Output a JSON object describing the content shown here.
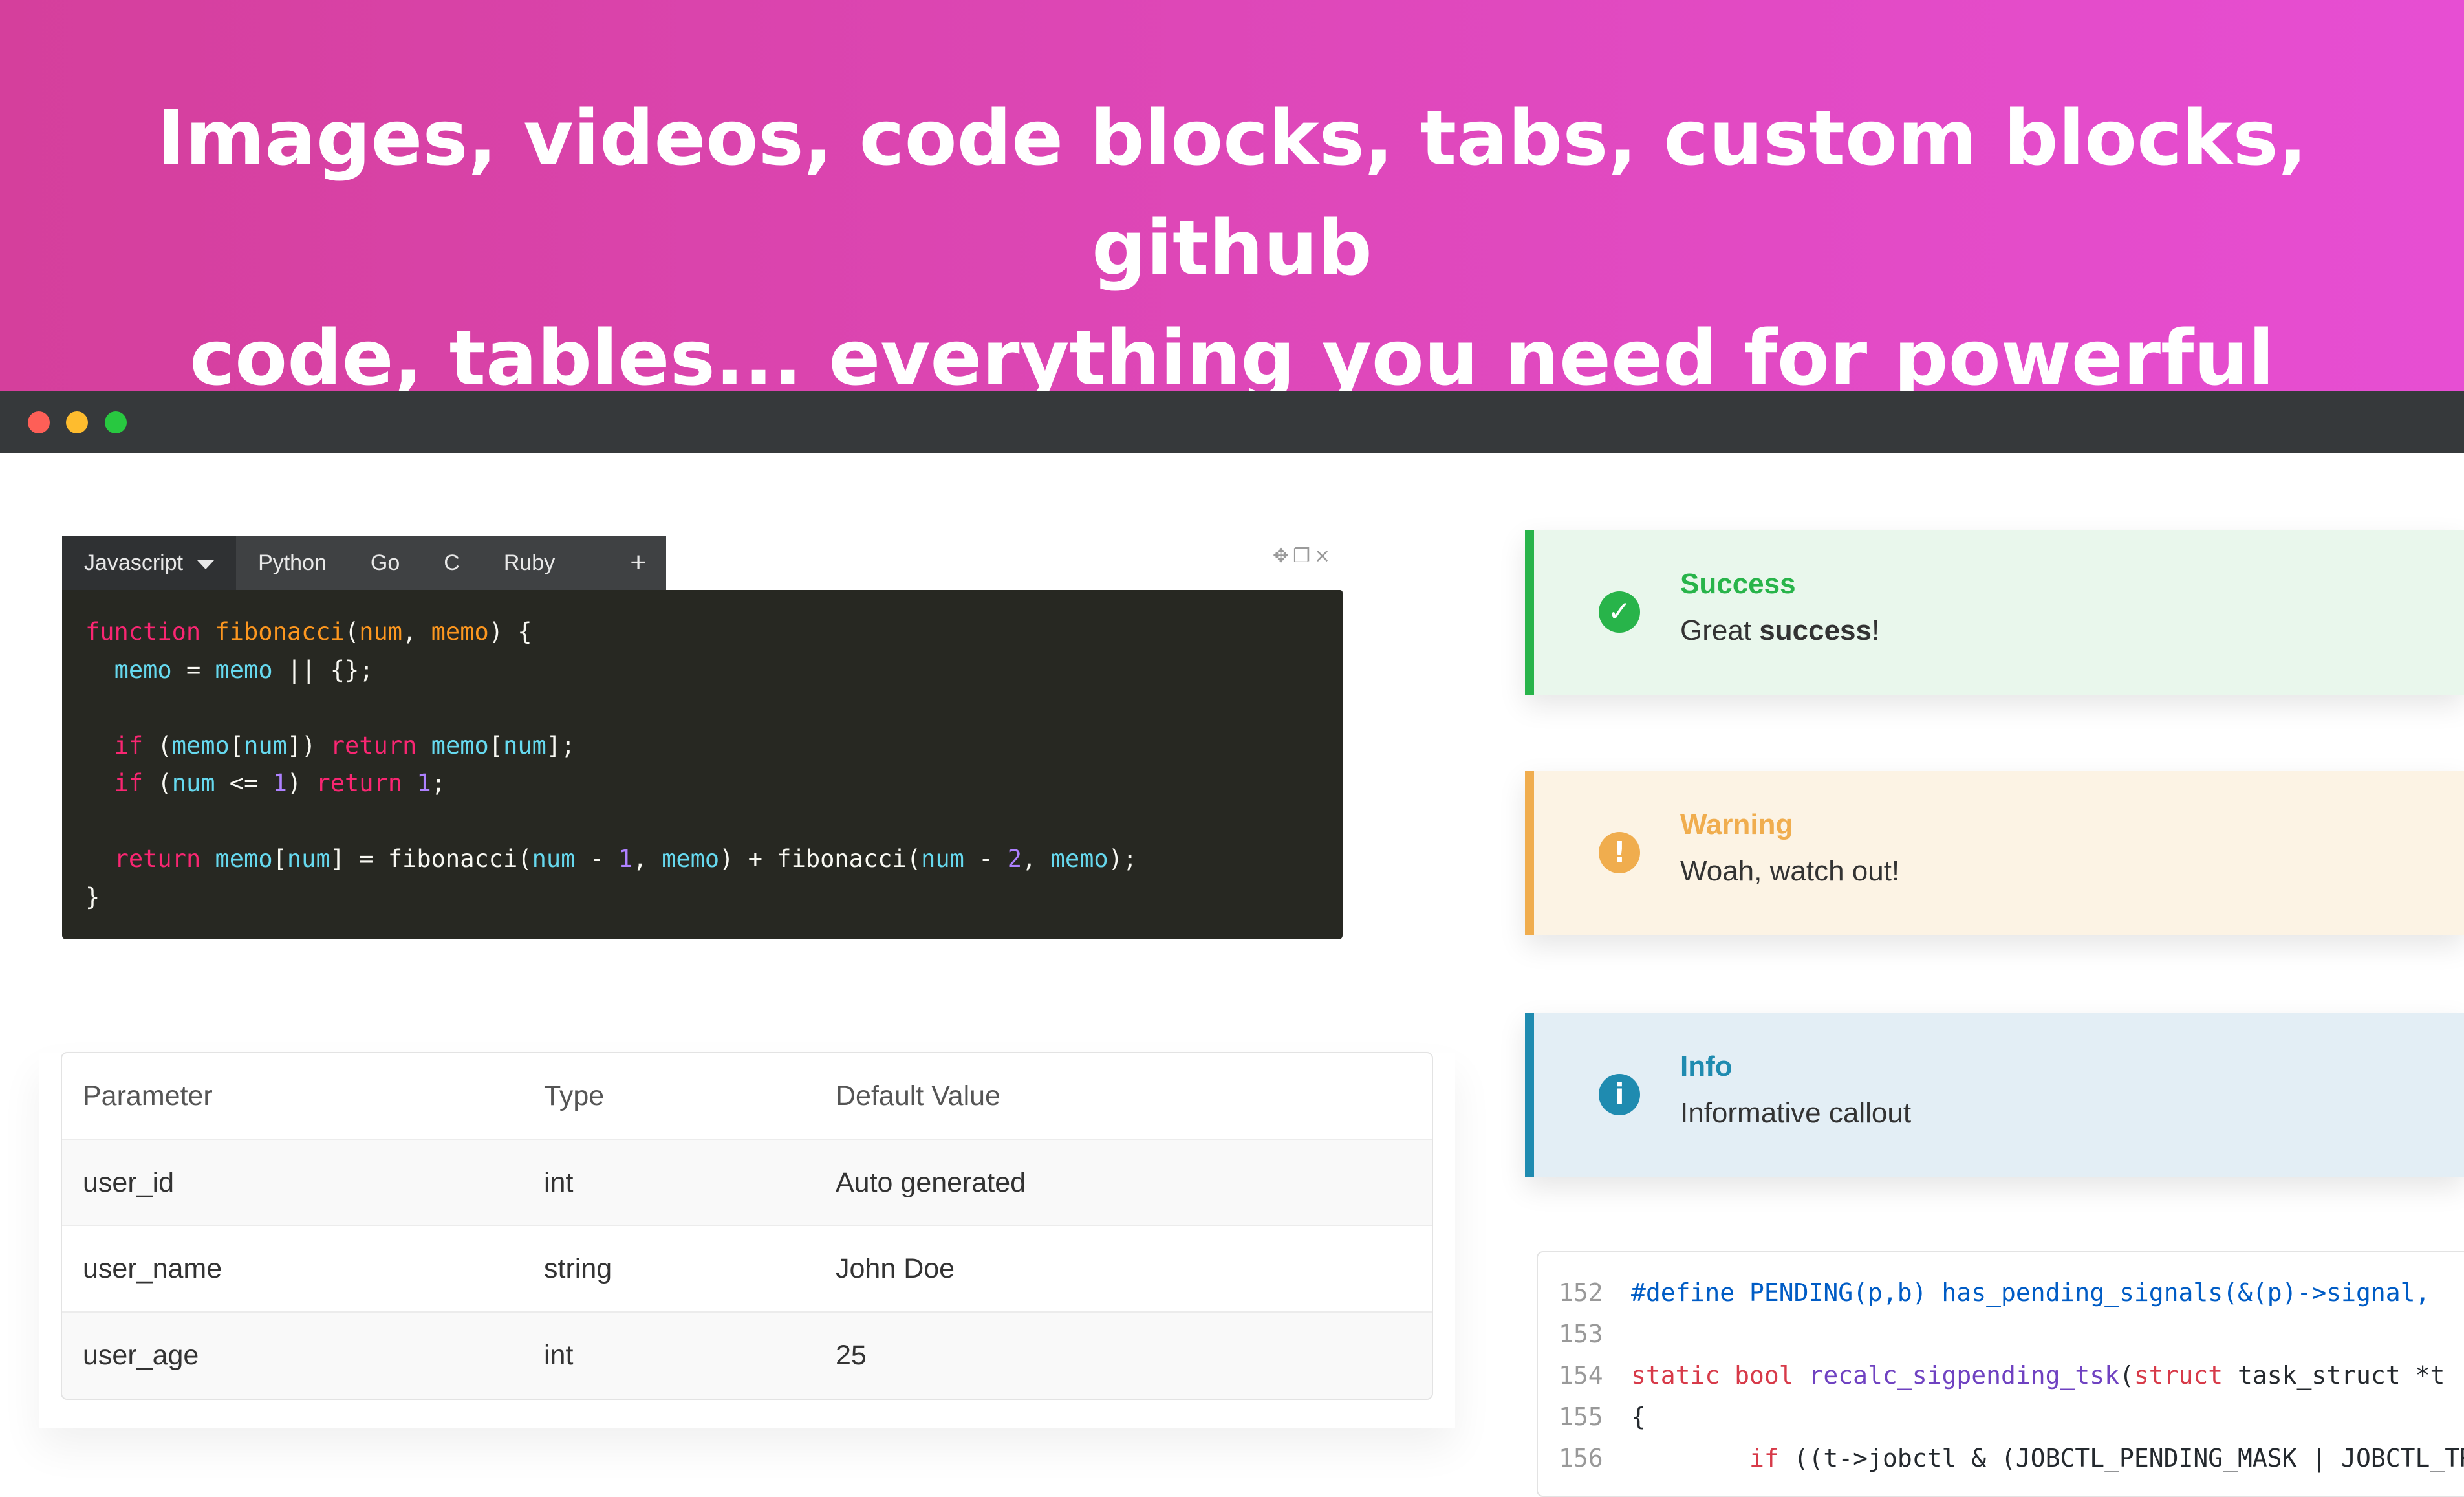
{
  "hero": {
    "line1": "Images, videos, code blocks, tabs, custom blocks, github",
    "line2": "code, tables... everything you need for powerful docs"
  },
  "window": {
    "buttons": [
      "close",
      "minimize",
      "maximize"
    ]
  },
  "code_tabs": {
    "tabs": [
      "Javascript",
      "Python",
      "Go",
      "C",
      "Ruby"
    ],
    "active_tab": "Javascript",
    "add_label": "+",
    "toolbar_icons": [
      "move-icon",
      "copy-icon",
      "close-icon"
    ],
    "toolbar_glyphs": [
      "✥",
      "❐",
      "×"
    ]
  },
  "code": {
    "lines": [
      [
        [
          "kw",
          "function "
        ],
        [
          "fn",
          "fibonacci"
        ],
        [
          "op",
          "("
        ],
        [
          "pa",
          "num"
        ],
        [
          "op",
          ", "
        ],
        [
          "pa",
          "memo"
        ],
        [
          "op",
          ") {"
        ]
      ],
      [
        [
          "op",
          "  "
        ],
        [
          "va",
          "memo"
        ],
        [
          "op",
          " = "
        ],
        [
          "va",
          "memo"
        ],
        [
          "op",
          " || {};"
        ]
      ],
      [],
      [
        [
          "op",
          "  "
        ],
        [
          "kw",
          "if"
        ],
        [
          "op",
          " ("
        ],
        [
          "va",
          "memo"
        ],
        [
          "op",
          "["
        ],
        [
          "va",
          "num"
        ],
        [
          "op",
          "]) "
        ],
        [
          "kw",
          "return"
        ],
        [
          "op",
          " "
        ],
        [
          "va",
          "memo"
        ],
        [
          "op",
          "["
        ],
        [
          "va",
          "num"
        ],
        [
          "op",
          "];"
        ]
      ],
      [
        [
          "op",
          "  "
        ],
        [
          "kw",
          "if"
        ],
        [
          "op",
          " ("
        ],
        [
          "va",
          "num"
        ],
        [
          "op",
          " <= "
        ],
        [
          "nu",
          "1"
        ],
        [
          "op",
          ") "
        ],
        [
          "kw",
          "return"
        ],
        [
          "op",
          " "
        ],
        [
          "nu",
          "1"
        ],
        [
          "op",
          ";"
        ]
      ],
      [],
      [
        [
          "op",
          "  "
        ],
        [
          "kw",
          "return"
        ],
        [
          "op",
          " "
        ],
        [
          "va",
          "memo"
        ],
        [
          "op",
          "["
        ],
        [
          "va",
          "num"
        ],
        [
          "op",
          "] = fibonacci("
        ],
        [
          "va",
          "num"
        ],
        [
          "op",
          " - "
        ],
        [
          "nu",
          "1"
        ],
        [
          "op",
          ", "
        ],
        [
          "va",
          "memo"
        ],
        [
          "op",
          ") + fibonacci("
        ],
        [
          "va",
          "num"
        ],
        [
          "op",
          " - "
        ],
        [
          "nu",
          "2"
        ],
        [
          "op",
          ", "
        ],
        [
          "va",
          "memo"
        ],
        [
          "op",
          ");"
        ]
      ],
      [
        [
          "op",
          "}"
        ]
      ]
    ]
  },
  "table": {
    "headers": [
      "Parameter",
      "Type",
      "Default Value"
    ],
    "rows": [
      [
        "user_id",
        "int",
        "Auto generated"
      ],
      [
        "user_name",
        "string",
        "John Doe"
      ],
      [
        "user_age",
        "int",
        "25"
      ]
    ]
  },
  "callouts": {
    "success": {
      "title": "Success",
      "body_prefix": "Great ",
      "body_bold": "success",
      "body_suffix": "!",
      "icon": "✓",
      "color": "#28b44a"
    },
    "warning": {
      "title": "Warning",
      "body": "Woah, watch out!",
      "icon": "!",
      "color": "#f0ad4e"
    },
    "info": {
      "title": "Info",
      "body": "Informative callout",
      "icon": "i",
      "color": "#1f8bb0"
    }
  },
  "github_code": {
    "lines": [
      {
        "num": "152",
        "tokens": [
          [
            "pp",
            "#define PENDING(p,b) has_pending_signals(&(p)->signal,"
          ]
        ]
      },
      {
        "num": "153",
        "tokens": []
      },
      {
        "num": "154",
        "tokens": [
          [
            "kw",
            "static "
          ],
          [
            "kw",
            "bool "
          ],
          [
            "fn",
            "recalc_sigpending_tsk"
          ],
          [
            "op",
            "("
          ],
          [
            "kw",
            "struct"
          ],
          [
            "op",
            " task_struct *t"
          ]
        ]
      },
      {
        "num": "155",
        "tokens": [
          [
            "op",
            "{"
          ]
        ]
      },
      {
        "num": "156",
        "tokens": [
          [
            "op",
            "        "
          ],
          [
            "kw",
            "if"
          ],
          [
            "op",
            " ((t->jobctl & (JOBCTL_PENDING_MASK | JOBCTL_TRAP_"
          ]
        ]
      }
    ]
  }
}
